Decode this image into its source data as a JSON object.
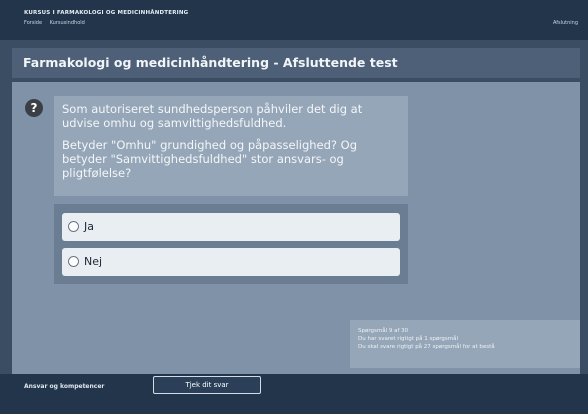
{
  "header": {
    "course_title": "KURSUS I FARMAKOLOGI OG MEDICINHÅNDTERING",
    "breadcrumbs": [
      "Forside",
      "Kursusindhold"
    ],
    "right_link": "Afslutning"
  },
  "page": {
    "title": "Farmakologi og medicinhåndtering - Afsluttende test"
  },
  "question": {
    "icon": "help-question-icon",
    "paragraph_1": "Som autoriseret sundhedsperson påhviler det dig at udvise omhu og samvittighedsfuldhed.",
    "paragraph_2": "Betyder \"Omhu\" grundighed og påpasselighed? Og betyder \"Samvittighedsfuldhed\" stor ansvars- og pligtfølelse?"
  },
  "answers": [
    {
      "label": "Ja"
    },
    {
      "label": "Nej"
    }
  ],
  "status": {
    "line_1": "Spørgsmål 9 af 30",
    "line_2": "Du har svaret rigtigt på 1 spørgsmål",
    "line_3": "Du skal svare rigtigt på 27 spørgsmål for at bestå"
  },
  "footer": {
    "left_label": "Ansvar og kompetencer",
    "submit_label": "Tjek dit svar"
  },
  "colors": {
    "background": "#3a4d63",
    "header": "#22354b",
    "panel": "#7f92a8",
    "question_box": "#95a6b8",
    "answer_option": "#e9eef3"
  }
}
